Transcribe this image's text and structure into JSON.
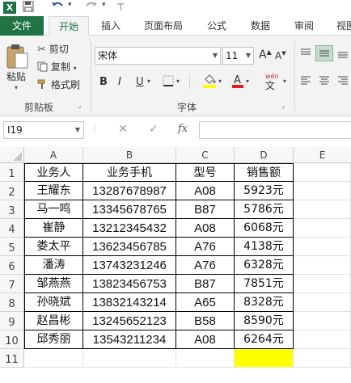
{
  "quick_access": {
    "app_icon": "X",
    "undo_icon": "undo-icon",
    "redo_icon": "redo-icon"
  },
  "tabs": [
    {
      "label": "文件"
    },
    {
      "label": "开始"
    },
    {
      "label": "插入"
    },
    {
      "label": "页面布局"
    },
    {
      "label": "公式"
    },
    {
      "label": "数据"
    },
    {
      "label": "审阅"
    },
    {
      "label": "视图"
    }
  ],
  "clipboard": {
    "paste": "粘贴",
    "cut": "剪切",
    "copy": "复制",
    "format_painter": "格式刷",
    "group": "剪贴板"
  },
  "font": {
    "name": "宋体",
    "size": "11",
    "group": "字体",
    "bold": "B",
    "italic": "I",
    "underline": "U",
    "grow": "A",
    "shrink": "A",
    "wen_top": "wén",
    "wen_bottom": "文"
  },
  "formula_bar": {
    "name_box": "I19",
    "cancel": "✕",
    "enter": "✓",
    "fx": "fx",
    "value": ""
  },
  "columns": [
    "A",
    "B",
    "C",
    "D",
    "E"
  ],
  "rows": [
    "1",
    "2",
    "3",
    "4",
    "5",
    "6",
    "7",
    "8",
    "9",
    "10",
    "11"
  ],
  "table": {
    "headers": [
      "业务人",
      "业务手机",
      "型号",
      "销售额"
    ],
    "data": [
      [
        "王耀东",
        "13287678987",
        "A08",
        "5923元"
      ],
      [
        "马一鸣",
        "13345678765",
        "B87",
        "5786元"
      ],
      [
        "崔静",
        "13212345432",
        "A08",
        "6068元"
      ],
      [
        "娄太平",
        "13623456785",
        "A76",
        "4138元"
      ],
      [
        "潘涛",
        "13743231246",
        "A76",
        "6328元"
      ],
      [
        "邹燕燕",
        "13823456753",
        "B87",
        "7851元"
      ],
      [
        "孙晓斌",
        "13832143214",
        "A65",
        "8328元"
      ],
      [
        "赵昌彬",
        "13245652123",
        "B58",
        "8590元"
      ],
      [
        "邱秀丽",
        "13543211234",
        "A08",
        "6264元"
      ]
    ]
  },
  "colors": {
    "excel_green": "#217346",
    "highlight": "#ffff00"
  }
}
